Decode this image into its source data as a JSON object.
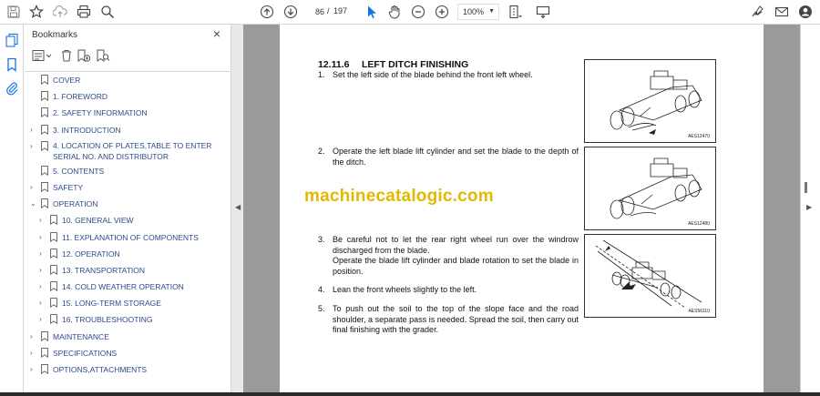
{
  "toolbar": {
    "page_current": "86",
    "page_separator": "/",
    "page_total": "197",
    "zoom": "100%"
  },
  "panel": {
    "title": "Bookmarks",
    "close_glyph": "×"
  },
  "bookmarks": [
    {
      "label": "COVER",
      "expander": ""
    },
    {
      "label": "1. FOREWORD",
      "expander": ""
    },
    {
      "label": "2. SAFETY INFORMATION",
      "expander": ""
    },
    {
      "label": "3. INTRODUCTION",
      "expander": "›"
    },
    {
      "label": "4. LOCATION OF PLATES,TABLE TO ENTER SERIAL NO. AND DISTRIBUTOR",
      "expander": "›"
    },
    {
      "label": "5. CONTENTS",
      "expander": ""
    },
    {
      "label": "SAFETY",
      "expander": "›"
    },
    {
      "label": "OPERATION",
      "expander": "⌄"
    },
    {
      "label": "10. GENERAL VIEW",
      "expander": "›"
    },
    {
      "label": "11. EXPLANATION OF COMPONENTS",
      "expander": "›"
    },
    {
      "label": "12. OPERATION",
      "expander": "›"
    },
    {
      "label": "13. TRANSPORTATION",
      "expander": "›"
    },
    {
      "label": "14. COLD WEATHER OPERATION",
      "expander": "›"
    },
    {
      "label": "15. LONG-TERM STORAGE",
      "expander": "›"
    },
    {
      "label": "16. TROUBLESHOOTING",
      "expander": "›"
    },
    {
      "label": "MAINTENANCE",
      "expander": "›"
    },
    {
      "label": "SPECIFICATIONS",
      "expander": "›"
    },
    {
      "label": "OPTIONS,ATTACHMENTS",
      "expander": "›"
    }
  ],
  "document": {
    "section_number": "12.11.6",
    "section_title": "LEFT DITCH FINISHING",
    "steps": [
      {
        "n": "1.",
        "text": "Set the left side of the blade behind the front left wheel."
      },
      {
        "n": "2.",
        "text": "Operate the left blade lift cylinder and set the blade to the depth of the ditch."
      },
      {
        "n": "3.",
        "text": "Be careful not to let the rear right wheel run over the windrow discharged from the blade."
      },
      {
        "n": "",
        "text": "Operate the blade lift cylinder and blade rotation to set the blade in position."
      },
      {
        "n": "4.",
        "text": "Lean the front wheels slightly to the left."
      },
      {
        "n": "5.",
        "text": "To push out the soil to the top of the slope face and the road shoulder, a separate pass is needed. Spread the soil, then carry out final finishing with the grader."
      }
    ],
    "watermark": "machinecatalogic.com",
    "figures": [
      {
        "code": "AES12470"
      },
      {
        "code": "AES12480"
      },
      {
        "code": "AES56110"
      }
    ]
  },
  "colors": {
    "bookmark_text": "#2c4a8c",
    "watermark": "#e3b800",
    "active_tool": "#1473e6",
    "doc_background": "#9a9a9a"
  },
  "icons": [
    "save-icon",
    "star-icon",
    "upload-icon",
    "print-icon",
    "zoom-search-icon",
    "prev-page-icon",
    "next-page-icon",
    "select-arrow-icon",
    "hand-icon",
    "zoom-out-icon",
    "zoom-in-icon",
    "fit-page-icon",
    "comment-icon",
    "sign-icon",
    "email-icon",
    "account-icon",
    "pages-icon",
    "bookmark-icon",
    "attachment-icon"
  ]
}
